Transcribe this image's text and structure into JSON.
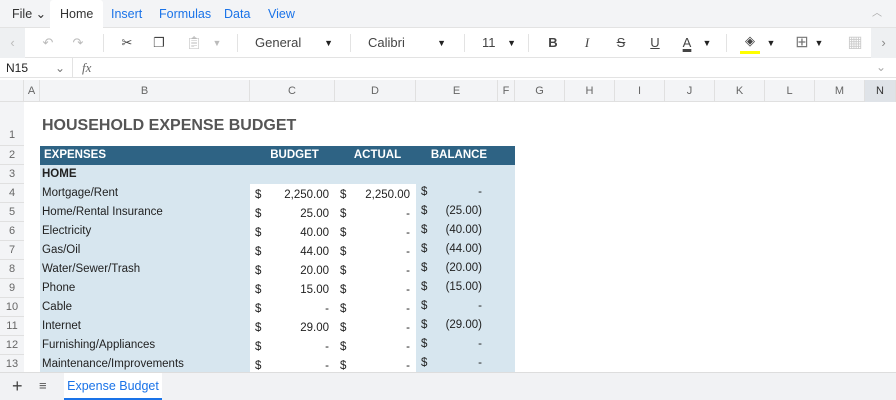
{
  "ribbon": {
    "file": "File",
    "tabs": [
      "Home",
      "Insert",
      "Formulas",
      "Data",
      "View"
    ]
  },
  "toolbar": {
    "number_format": "General",
    "font": "Calibri",
    "font_size": "11",
    "bold": "B",
    "italic": "I",
    "strike": "S",
    "underline": "U",
    "font_color": "A",
    "font_color_hex": "#000000",
    "fill_color_hex": "#ffff00"
  },
  "formula_bar": {
    "name_box": "N15",
    "fx": "fx",
    "value": ""
  },
  "columns": [
    "A",
    "B",
    "C",
    "D",
    "E",
    "F",
    "G",
    "H",
    "I",
    "J",
    "K",
    "L",
    "M",
    "N"
  ],
  "rows": [
    "1",
    "2",
    "3",
    "4",
    "5",
    "6",
    "7",
    "8",
    "9",
    "10",
    "11",
    "12",
    "13"
  ],
  "sheet": {
    "title": "HOUSEHOLD EXPENSE BUDGET",
    "headers": [
      "EXPENSES",
      "BUDGET",
      "ACTUAL",
      "BALANCE"
    ],
    "section": "HOME",
    "currency": "$",
    "items": [
      {
        "name": "Mortgage/Rent",
        "budget": "2,250.00",
        "actual": "2,250.00",
        "balance": "-"
      },
      {
        "name": "Home/Rental Insurance",
        "budget": "25.00",
        "actual": "-",
        "balance": "(25.00)"
      },
      {
        "name": "Electricity",
        "budget": "40.00",
        "actual": "-",
        "balance": "(40.00)"
      },
      {
        "name": "Gas/Oil",
        "budget": "44.00",
        "actual": "-",
        "balance": "(44.00)"
      },
      {
        "name": "Water/Sewer/Trash",
        "budget": "20.00",
        "actual": "-",
        "balance": "(20.00)"
      },
      {
        "name": "Phone",
        "budget": "15.00",
        "actual": "-",
        "balance": "(15.00)"
      },
      {
        "name": "Cable",
        "budget": "-",
        "actual": "-",
        "balance": "-"
      },
      {
        "name": "Internet",
        "budget": "29.00",
        "actual": "-",
        "balance": "(29.00)"
      },
      {
        "name": "Furnishing/Appliances",
        "budget": "-",
        "actual": "-",
        "balance": "-"
      },
      {
        "name": "Maintenance/Improvements",
        "budget": "-",
        "actual": "-",
        "balance": "-"
      }
    ]
  },
  "colors": {
    "header": "#2e6384",
    "band": "#d7e6ef",
    "accent": "#1a73e8"
  },
  "sheet_tabs": [
    "Expense Budget"
  ]
}
